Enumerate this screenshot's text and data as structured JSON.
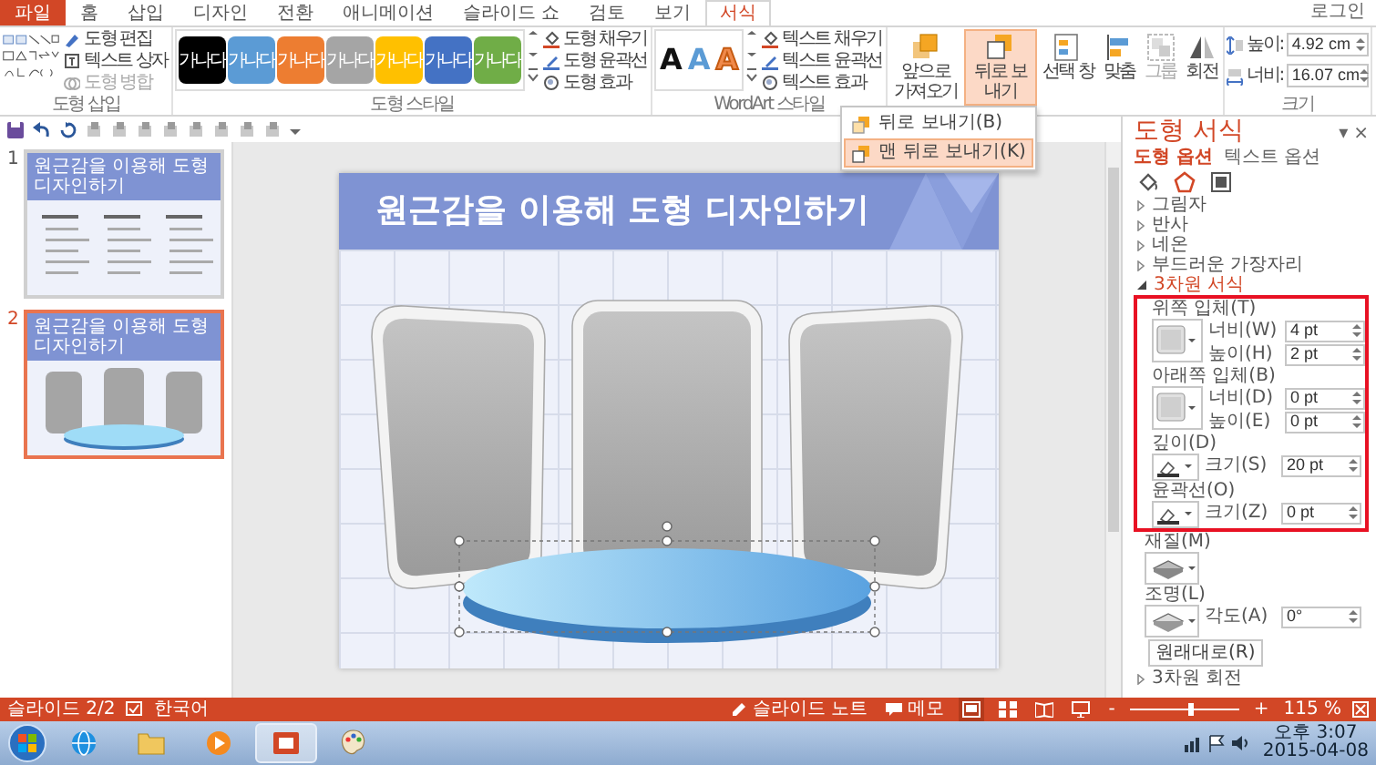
{
  "tabs": [
    {
      "label": "파일",
      "kind": "file",
      "selected": false
    },
    {
      "label": "홈",
      "kind": "tab",
      "selected": false
    },
    {
      "label": "삽입",
      "kind": "tab",
      "selected": false
    },
    {
      "label": "디자인",
      "kind": "tab",
      "selected": false
    },
    {
      "label": "전환",
      "kind": "tab",
      "selected": false
    },
    {
      "label": "애니메이션",
      "kind": "tab",
      "selected": false
    },
    {
      "label": "슬라이드 쇼",
      "kind": "tab",
      "selected": false
    },
    {
      "label": "검토",
      "kind": "tab",
      "selected": false
    },
    {
      "label": "보기",
      "kind": "tab",
      "selected": false
    },
    {
      "label": "서식",
      "kind": "tab",
      "selected": true
    }
  ],
  "account": "로그인",
  "ribbon": {
    "insert_shapes": {
      "commands": [
        {
          "label": "도형 편집",
          "kind": "edit",
          "disabled": false
        },
        {
          "label": "텍스트 상자",
          "kind": "textbox",
          "disabled": false
        },
        {
          "label": "도형 병합",
          "kind": "merge",
          "disabled": true
        }
      ],
      "group_label": "도형 삽입"
    },
    "shape_styles": {
      "swatches": [
        {
          "label": "가나다",
          "color": "#000000"
        },
        {
          "label": "가나다",
          "color": "#5b9bd5"
        },
        {
          "label": "가나다",
          "color": "#ed7d31"
        },
        {
          "label": "가나다",
          "color": "#a5a5a5"
        },
        {
          "label": "가나다",
          "color": "#ffc000"
        },
        {
          "label": "가나다",
          "color": "#4472c4"
        },
        {
          "label": "가나다",
          "color": "#70ad47"
        }
      ],
      "commands": [
        {
          "label": "도형 채우기",
          "kind": "fill"
        },
        {
          "label": "도형 윤곽선",
          "kind": "outline"
        },
        {
          "label": "도형 효과",
          "kind": "effects"
        }
      ],
      "group_label": "도형 스타일"
    },
    "wordart_styles": {
      "letters": [
        {
          "label": "A",
          "kind": "solid"
        },
        {
          "label": "A",
          "kind": "gradient"
        },
        {
          "label": "A",
          "kind": "outline"
        }
      ],
      "commands": [
        {
          "label": "텍스트 채우기",
          "kind": "fill"
        },
        {
          "label": "텍스트 윤곽선",
          "kind": "outline"
        },
        {
          "label": "텍스트 효과",
          "kind": "effects"
        }
      ],
      "group_label": "WordArt 스타일"
    },
    "arrange": {
      "buttons": [
        {
          "label": "앞으로 가져오기",
          "kind": "forward",
          "selected": false,
          "disabled": false
        },
        {
          "label": "뒤로 보내기",
          "kind": "backward",
          "selected": true,
          "disabled": false
        },
        {
          "label": "선택 창",
          "kind": "selection",
          "selected": false,
          "disabled": false
        },
        {
          "label": "맞춤",
          "kind": "align",
          "selected": false,
          "disabled": false
        },
        {
          "label": "그룹",
          "kind": "group",
          "selected": false,
          "disabled": true
        },
        {
          "label": "회전",
          "kind": "rotate",
          "selected": false,
          "disabled": false
        }
      ]
    },
    "size": {
      "fields": [
        {
          "label": "높이:",
          "kind": "height",
          "value": "4.92 cm"
        },
        {
          "label": "너비:",
          "kind": "width",
          "value": "16.07 cm"
        }
      ],
      "group_label": "크기"
    }
  },
  "send_backward_menu": {
    "items": [
      {
        "label": "뒤로 보내기(B)",
        "kind": "backward",
        "selected": false
      },
      {
        "label": "맨 뒤로 보내기(K)",
        "kind": "back",
        "selected": true
      }
    ]
  },
  "slides": [
    {
      "number": "1",
      "title": "원근감을 이용해 도형 디자인하기",
      "kind": "text",
      "selected": false
    },
    {
      "number": "2",
      "title": "원근감을 이용해 도형 디자인하기",
      "kind": "shapes",
      "selected": true
    }
  ],
  "slide": {
    "title": "원근감을 이용해 도형 디자인하기"
  },
  "format_pane": {
    "title": "도형 서식",
    "menu_glyph": "▾",
    "close_glyph": "×",
    "tabs": [
      {
        "label": "도형 옵션",
        "selected": true
      },
      {
        "label": "텍스트 옵션",
        "selected": false
      }
    ],
    "icon_tabs": [
      {
        "kind": "fill",
        "selected": false
      },
      {
        "kind": "effects",
        "selected": true
      },
      {
        "kind": "size",
        "selected": false
      }
    ],
    "sections": [
      {
        "label": "그림자",
        "expanded": false
      },
      {
        "label": "반사",
        "expanded": false
      },
      {
        "label": "네온",
        "expanded": false
      },
      {
        "label": "부드러운 가장자리",
        "expanded": false
      },
      {
        "label": "3차원 서식",
        "expanded": true,
        "reset_button": "원래대로(R)",
        "groups": [
          {
            "label": "위쪽 입체(T)",
            "kind": "bevel",
            "highlighted": true,
            "fields": [
              {
                "label": "너비(W)",
                "value": "4 pt"
              },
              {
                "label": "높이(H)",
                "value": "2 pt"
              }
            ]
          },
          {
            "label": "아래쪽 입체(B)",
            "kind": "bevel",
            "highlighted": true,
            "fields": [
              {
                "label": "너비(D)",
                "value": "0 pt"
              },
              {
                "label": "높이(E)",
                "value": "0 pt"
              }
            ]
          },
          {
            "label": "깊이(D)",
            "kind": "color",
            "highlighted": true,
            "fields": [
              {
                "label": "크기(S)",
                "value": "20 pt"
              }
            ]
          },
          {
            "label": "윤곽선(O)",
            "kind": "color",
            "highlighted": true,
            "fields": [
              {
                "label": "크기(Z)",
                "value": "0 pt"
              }
            ]
          },
          {
            "label": "재질(M)",
            "kind": "material",
            "highlighted": false
          },
          {
            "label": "조명(L)",
            "kind": "lighting",
            "highlighted": false,
            "fields": [
              {
                "label": "각도(A)",
                "value": "0°"
              }
            ]
          }
        ]
      },
      {
        "label": "3차원 회전",
        "expanded": false
      }
    ]
  },
  "status_bar": {
    "slide_indicator": "슬라이드 2/2",
    "language": "한국어",
    "notes": "슬라이드 노트",
    "comments": "메모",
    "views": [
      {
        "kind": "normal",
        "selected": true
      },
      {
        "kind": "sorter",
        "selected": false
      },
      {
        "kind": "reading",
        "selected": false
      },
      {
        "kind": "slideshow",
        "selected": false
      }
    ],
    "zoom": {
      "minus": "-",
      "plus": "+",
      "level": 0.55,
      "reading": "115 %"
    }
  },
  "taskbar": {
    "apps": [
      {
        "kind": "browser",
        "selected": false
      },
      {
        "kind": "folder",
        "selected": false
      },
      {
        "kind": "media",
        "selected": false
      },
      {
        "kind": "presentation",
        "selected": true
      },
      {
        "kind": "paint",
        "selected": false
      }
    ],
    "time": "오후 3:07",
    "date": "2015-04-08"
  }
}
